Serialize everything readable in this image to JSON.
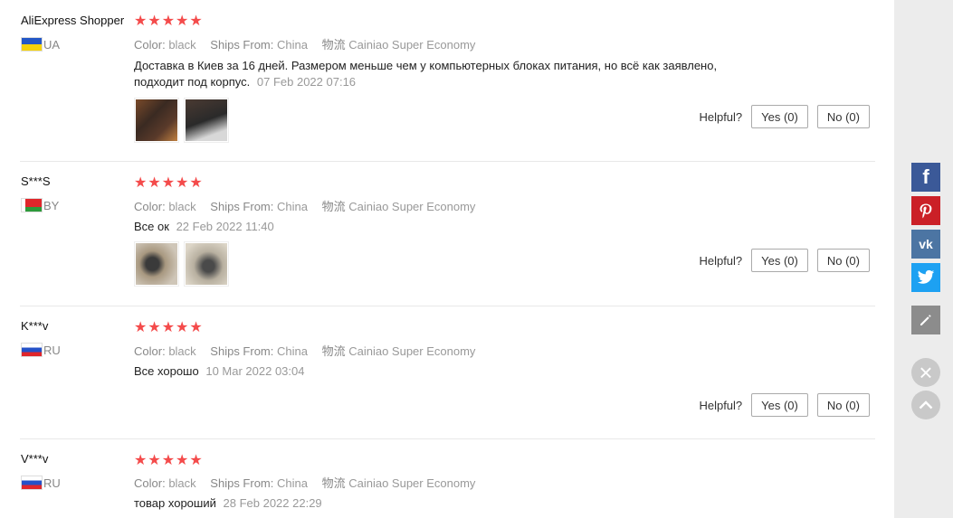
{
  "reviews": [
    {
      "name": "AliExpress Shopper",
      "country": "UA",
      "stars": "★★★★★",
      "color_label": "Color:",
      "color_value": "black",
      "ships_label": "Ships From:",
      "ships_value": "China",
      "logistics_label": "物流",
      "logistics_value": "Cainiao Super Economy",
      "text": "Доставка в Киев за 16 дней. Размером меньше чем у компьютерных блоках питания, но всё как заявлено, подходит под корпус.",
      "date": "07 Feb 2022 07:16",
      "helpful_label": "Helpful?",
      "yes_label": "Yes (0)",
      "no_label": "No (0)"
    },
    {
      "name": "S***S",
      "country": "BY",
      "stars": "★★★★★",
      "color_label": "Color:",
      "color_value": "black",
      "ships_label": "Ships From:",
      "ships_value": "China",
      "logistics_label": "物流",
      "logistics_value": "Cainiao Super Economy",
      "text": "Все ок",
      "date": "22 Feb 2022 11:40",
      "helpful_label": "Helpful?",
      "yes_label": "Yes (0)",
      "no_label": "No (0)"
    },
    {
      "name": "K***v",
      "country": "RU",
      "stars": "★★★★★",
      "color_label": "Color:",
      "color_value": "black",
      "ships_label": "Ships From:",
      "ships_value": "China",
      "logistics_label": "物流",
      "logistics_value": "Cainiao Super Economy",
      "text": "Все хорошо",
      "date": "10 Mar 2022 03:04",
      "helpful_label": "Helpful?",
      "yes_label": "Yes (0)",
      "no_label": "No (0)"
    },
    {
      "name": "V***v",
      "country": "RU",
      "stars": "★★★★★",
      "color_label": "Color:",
      "color_value": "black",
      "ships_label": "Ships From:",
      "ships_value": "China",
      "logistics_label": "物流",
      "logistics_value": "Cainiao Super Economy",
      "text": "товар хороший",
      "date": "28 Feb 2022 22:29"
    }
  ],
  "share": {
    "facebook_icon": "f",
    "pinterest_icon": "P",
    "vk_icon": "vk",
    "twitter_icon": "twitter",
    "edit_icon": "pencil",
    "close_icon": "×",
    "top_icon": "chevron-up"
  },
  "colors": {
    "star": "#f44b4b",
    "facebook": "#3b5998",
    "pinterest": "#cb2027",
    "vk": "#4c75a3",
    "twitter": "#1da1f2",
    "edit": "#8c8c8c"
  }
}
